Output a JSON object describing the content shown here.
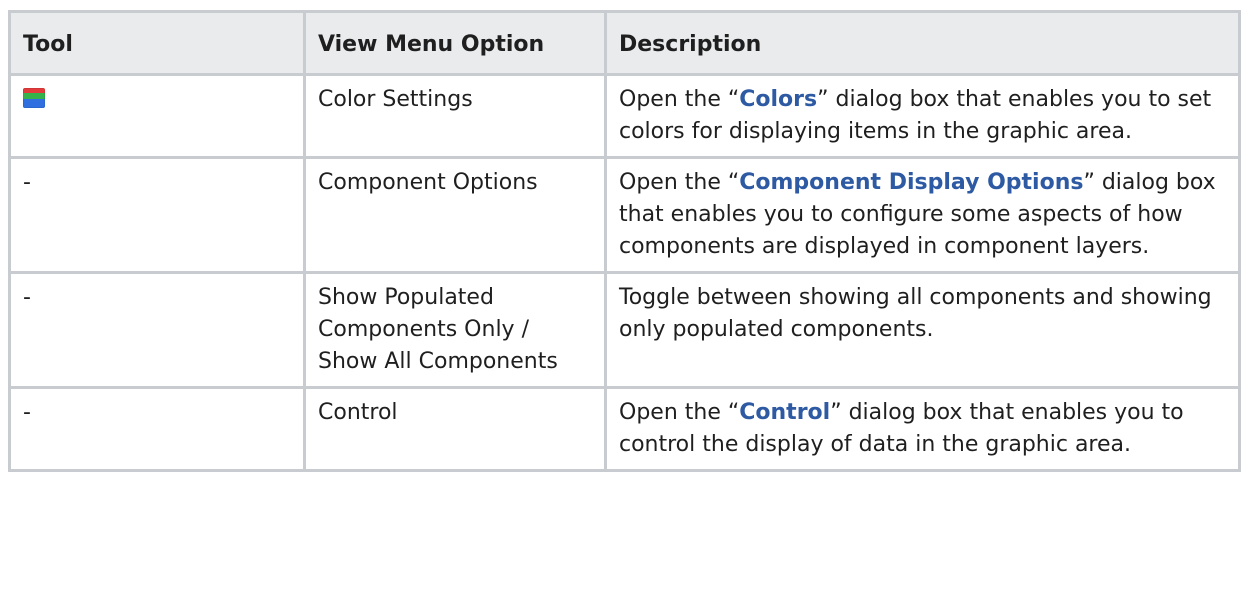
{
  "table": {
    "headers": [
      "Tool",
      "View Menu Option",
      "Description"
    ],
    "rows": [
      {
        "tool": "",
        "tool_icon": "color-settings-icon",
        "option": "Color Settings",
        "desc_before": "Open the “",
        "desc_link": "Colors",
        "desc_after": "” dialog box that enables you to set colors for displaying items in the graphic area."
      },
      {
        "tool": "-",
        "option": "Component Options",
        "desc_before": "Open the “",
        "desc_link": "Component Display Options",
        "desc_after": "” dialog box that enables you to configure some aspects of how components are displayed in component layers."
      },
      {
        "tool": "-",
        "option": "Show Populated Components Only / Show All Components",
        "desc": "Toggle between showing all components and showing only populated components."
      },
      {
        "tool": "-",
        "option": "Control",
        "desc_before": "Open the “",
        "desc_link": "Control",
        "desc_after": "” dialog box that enables you to control the display of data in the graphic area."
      }
    ]
  },
  "colors": {
    "link": "#2d5aa3",
    "header_bg": "#e9ebed",
    "border": "#c8ccd1"
  }
}
